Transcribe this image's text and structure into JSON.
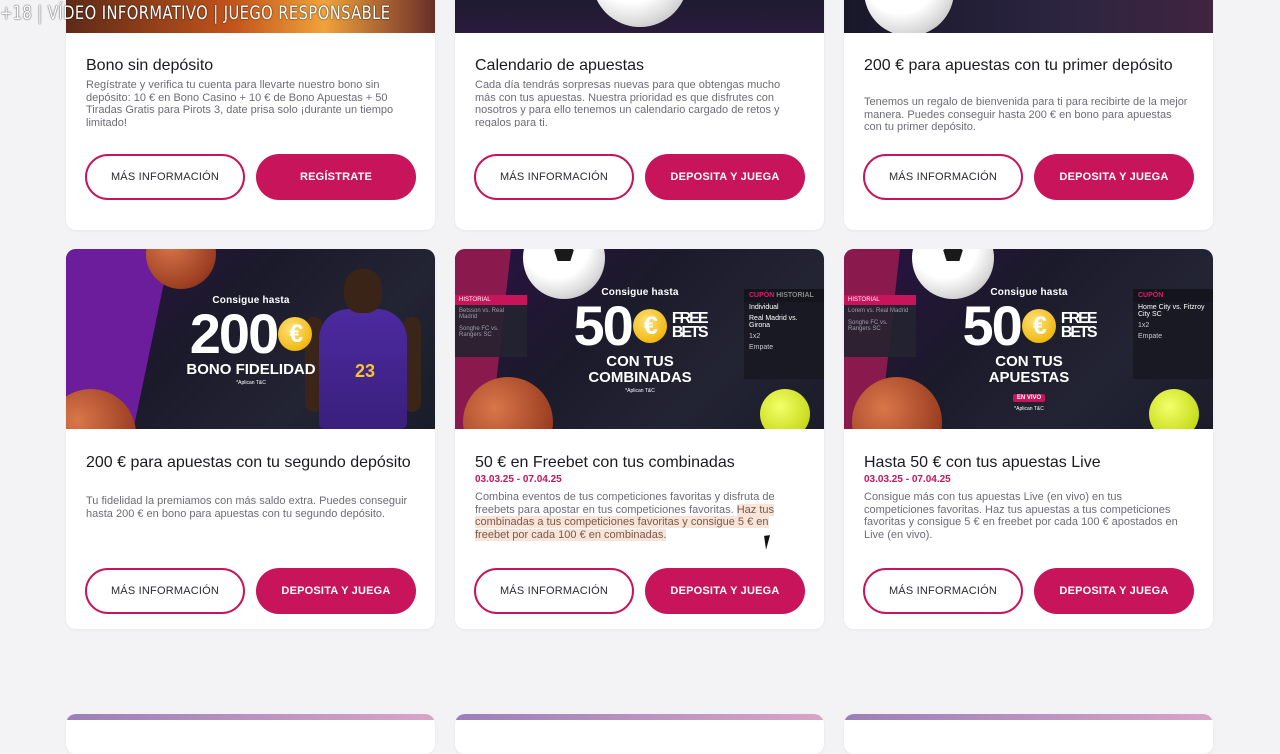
{
  "overlay_notice": "+18 | VÍDEO INFORMATIVO | JUEGO RESPONSABLE",
  "colors": {
    "accent": "#c7145a",
    "background": "#f3f3f6",
    "card": "#ffffff"
  },
  "top_row": [
    {
      "title": "Bono sin depósito",
      "description": "Regístrate y verifica tu cuenta para llevarte nuestro bono sin depósito: 10 € en Bono Casino + 10 € de Bono Apuestas + 50 Tiradas Gratis para Pirots 3, date prisa solo ¡durante un tiempo limitado!",
      "info_label": "MÁS INFORMACIÓN",
      "cta_label": "REGÍSTRATE"
    },
    {
      "title": "Calendario de apuestas",
      "description": "Cada día tendrás sorpresas nuevas para que obtengas mucho más con tus apuestas. Nuestra prioridad es que disfrutes con nosotros y para ello tenemos un calendario cargado de retos y regalos para ti.",
      "info_label": "MÁS INFORMACIÓN",
      "cta_label": "DEPOSITA Y JUEGA"
    },
    {
      "title": "200 € para apuestas con tu primer depósito",
      "description": "Tenemos un regalo de bienvenida para ti para recibirte de la mejor manera. Puedes conseguir hasta 200 € en bono para apuestas con tu primer depósito.",
      "info_label": "MÁS INFORMACIÓN",
      "cta_label": "DEPOSITA Y JUEGA"
    }
  ],
  "middle_row": [
    {
      "banner": {
        "kicker": "Consigue hasta",
        "amount": "200",
        "currency": "€",
        "line1": "BONO FIDELIDAD",
        "legal": "*Aplican T&C",
        "jersey_number": "23"
      },
      "title": "200 € para apuestas con tu segundo depósito",
      "description": "Tu fidelidad la premiamos con más saldo extra. Puedes conseguir hasta 200 € en bono para apuestas con tu segundo depósito.",
      "info_label": "MÁS INFORMACIÓN",
      "cta_label": "DEPOSITA Y JUEGA"
    },
    {
      "banner": {
        "kicker": "Consigue hasta",
        "amount": "50",
        "currency": "€",
        "free": "FREE",
        "bets": "BETS",
        "line1": "CON TUS",
        "line2": "COMBINADAS",
        "legal": "*Aplican T&C",
        "coupon_tab": "CUPÓN",
        "history_tab": "HISTORIAL",
        "coupon_mode": "Individual",
        "coupon_match": "Real Madrid vs. Girona",
        "coupon_pick": "1x2",
        "coupon_result": "Empate",
        "ticket_tab": "HISTORIAL",
        "ticket_row1": "Betsson vs. Real Madrid",
        "ticket_row2": "Songhe FC vs. Rangers SC"
      },
      "title": "50 € en Freebet con tus combinadas",
      "dates": "03.03.25 - 07.04.25",
      "description_plain": "Combina eventos de tus competiciones favoritas y disfruta de freebets para apostar en tus competiciones favoritas.",
      "description_highlight": "Haz tus combinadas a tus competiciones favoritas y consigue 5 € en freebet por cada 100 € en combinadas.",
      "info_label": "MÁS INFORMACIÓN",
      "cta_label": "DEPOSITA Y JUEGA"
    },
    {
      "banner": {
        "kicker": "Consigue hasta",
        "amount": "50",
        "currency": "€",
        "free": "FREE",
        "bets": "BETS",
        "line1": "CON TUS",
        "line2": "APUESTAS",
        "live_tag": "EN VIVO",
        "legal": "*Aplican T&C",
        "coupon_tab": "CUPÓN",
        "coupon_match": "Home City vs. Fitzroy City SC",
        "coupon_pick": "1x2",
        "coupon_result": "Empate",
        "ticket_row1": "Lorem vs. Real Madrid",
        "ticket_row2": "Songhe FC vs. Rangers SC"
      },
      "title": "Hasta 50 € con tus apuestas Live",
      "dates": "03.03.25 - 07.04.25",
      "description": "Consigue más con tus apuestas Live (en vivo) en tus competiciones favoritas. Haz tus apuestas a tus competiciones favoritas y consigue 5 € en freebet por cada 100 € apostados en Live (en vivo).",
      "info_label": "MÁS INFORMACIÓN",
      "cta_label": "DEPOSITA Y JUEGA"
    }
  ]
}
